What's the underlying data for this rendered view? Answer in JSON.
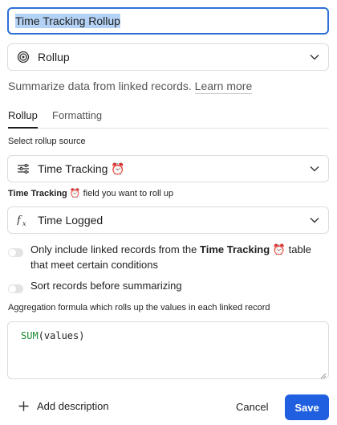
{
  "field_name": {
    "value": "Time Tracking Rollup"
  },
  "field_type": {
    "label": "Rollup",
    "icon": "rollup-icon"
  },
  "description": {
    "text": "Summarize data from linked records.",
    "link": "Learn more"
  },
  "tabs": [
    {
      "label": "Rollup",
      "active": true
    },
    {
      "label": "Formatting",
      "active": false
    }
  ],
  "source": {
    "label": "Select rollup source",
    "value": "Time Tracking",
    "emoji": "⏰",
    "icon": "linked-records-icon"
  },
  "target_field": {
    "label_table": "Time Tracking",
    "label_emoji": "⏰",
    "label_suffix": "field you want to roll up",
    "value": "Time Logged",
    "icon": "formula-fx-icon"
  },
  "options": {
    "conditions": {
      "prefix": "Only include linked records from the",
      "table": "Time Tracking",
      "emoji": "⏰",
      "suffix": "table that meet certain conditions",
      "enabled": false
    },
    "sort": {
      "label": "Sort records before summarizing",
      "enabled": false
    }
  },
  "aggregation": {
    "label": "Aggregation formula which rolls up the values in each linked record",
    "formula_fn": "SUM",
    "formula_args": "(values)"
  },
  "footer": {
    "add_description": "Add description",
    "cancel": "Cancel",
    "save": "Save"
  },
  "colors": {
    "accent": "#1f5fe0",
    "focus_border": "#2f6fd8",
    "formula_fn": "#198a2f"
  }
}
